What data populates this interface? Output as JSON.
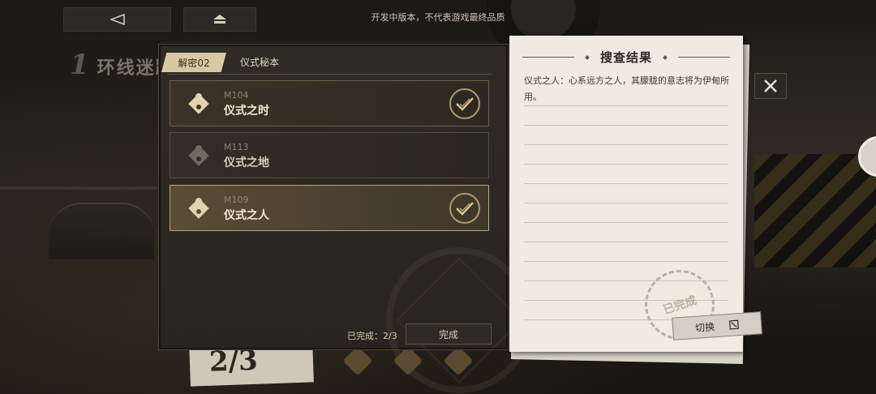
{
  "watermark": "开发中版本，不代表游戏最终品质",
  "top_bar": {
    "back_icon": "back-triangle-icon",
    "home_icon": "home-icon"
  },
  "background": {
    "chapter_number": "1",
    "chapter_title": "环线迷踪",
    "counter": "2/3"
  },
  "panel": {
    "tab_label": "解密02",
    "title": "仪式秘本",
    "items": [
      {
        "code": "M104",
        "name": "仪式之时",
        "state": "completed"
      },
      {
        "code": "M113",
        "name": "仪式之地",
        "state": "locked"
      },
      {
        "code": "M109",
        "name": "仪式之人",
        "state": "completed-selected"
      }
    ],
    "progress_label": "已完成：2/3",
    "done_button": "完成"
  },
  "notebook": {
    "title": "搜查结果",
    "text": "仪式之人：心系远方之人，其朦胧的意志将为伊甸所用。",
    "stamp": "已完成",
    "switch_button": "切换"
  },
  "colors": {
    "accent_gold": "#b19b6f",
    "paper": "#efebe2",
    "tab": "#d9c9a3"
  }
}
